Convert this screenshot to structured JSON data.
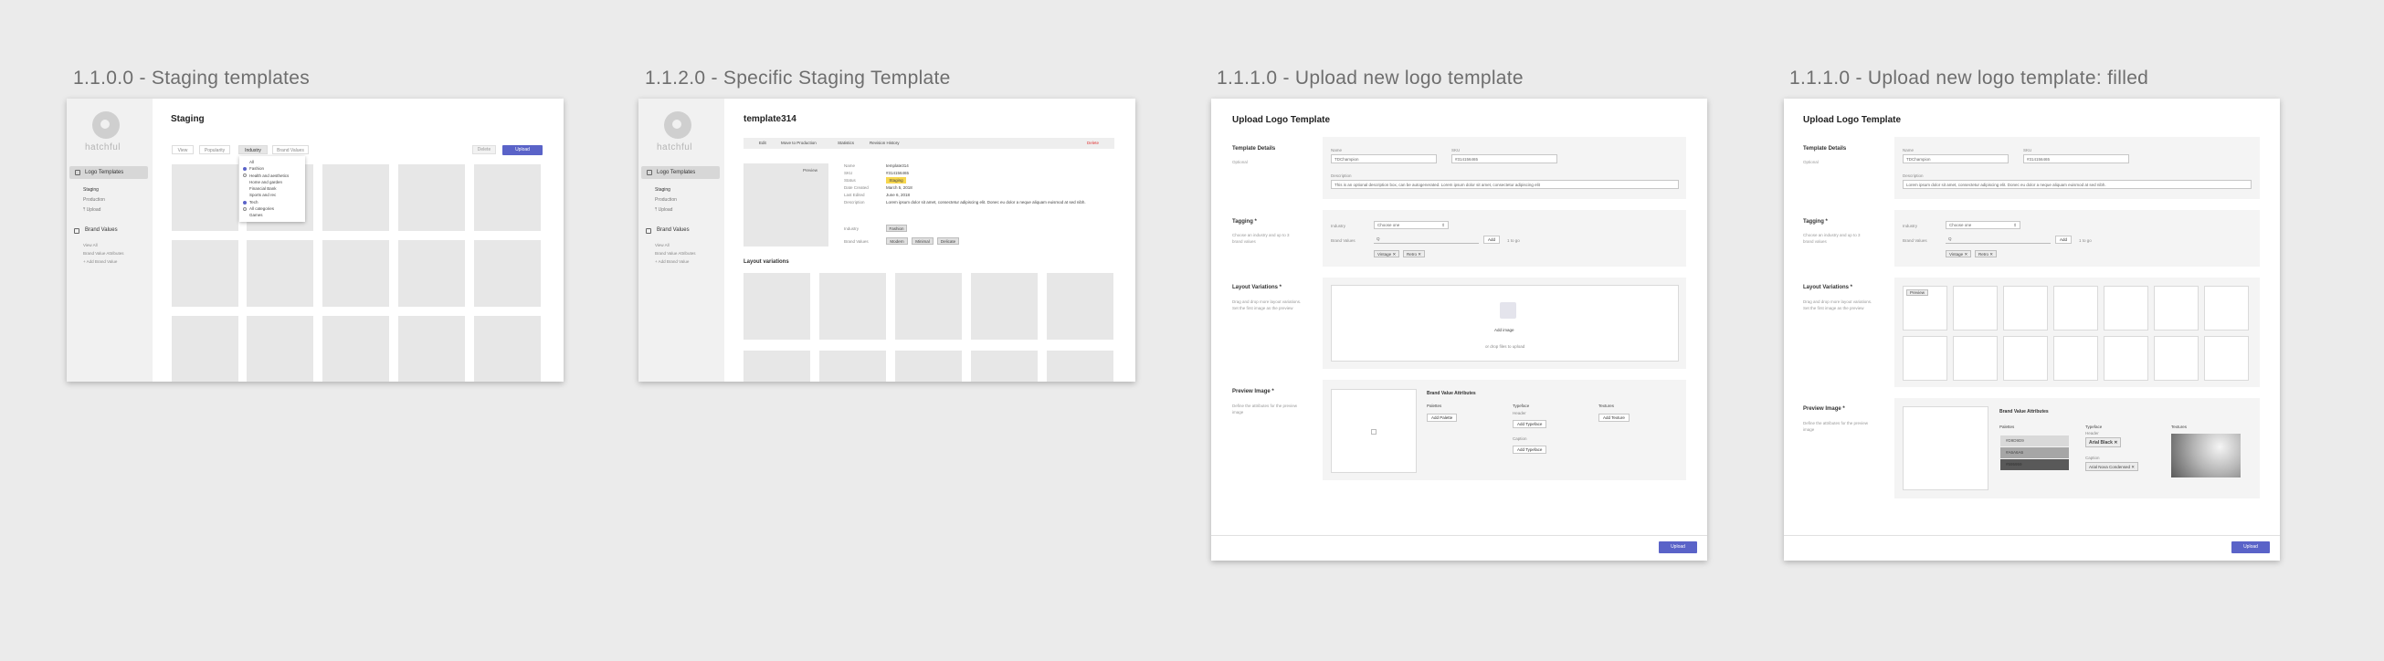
{
  "boards": [
    {
      "title": "1.1.0.0 - Staging templates"
    },
    {
      "title": "1.1.2.0 - Specific Staging Template"
    },
    {
      "title": "1.1.1.0 - Upload new logo template"
    },
    {
      "title": "1.1.1.0 - Upload new logo template: filled"
    }
  ],
  "sidebar": {
    "logo_text": "hatchful",
    "logo_templates": "Logo Templates",
    "staging": "Staging",
    "production": "Production",
    "upload": "Upload",
    "brand_values": "Brand Values",
    "view_all": "View All",
    "brand_value_attributes": "Brand Value Attributes",
    "add_brand_value": "Add Brand Value"
  },
  "staging": {
    "title": "Staging",
    "tabs": [
      "View",
      "Popularity",
      "Industry",
      "Brand Values"
    ],
    "active_tab": "Industry",
    "delete": "Delete",
    "upload": "Upload",
    "dropdown": [
      "All",
      "Fashion",
      "Health and aesthetics",
      "Home and garden",
      "Financial Bank",
      "Sports and rec",
      "Tech",
      "All categories",
      "Games"
    ],
    "dropdown_selected": [
      1,
      6
    ]
  },
  "specific": {
    "title": "template314",
    "tabs": [
      "Edit",
      "Move to Production",
      "Statistics",
      "Revision History"
    ],
    "delete": "Delete",
    "preview": "Preview",
    "fields": [
      {
        "label": "Name",
        "value": "template314"
      },
      {
        "label": "SKU",
        "value": "#314156465"
      },
      {
        "label": "Status",
        "value": "Staging"
      },
      {
        "label": "Date Created",
        "value": "March 5, 2018"
      },
      {
        "label": "Last Edited",
        "value": "June 6, 2018"
      },
      {
        "label": "Description",
        "value": "Lorem ipsum dolor sit amet, consectetur adipiscing elit. Donec eu dolor a neque aliquam euismod at sed nibh."
      }
    ],
    "industry_label": "Industry",
    "industry": "Fashion",
    "brand_values_label": "Brand Values",
    "brand_values": [
      "Modern",
      "Minimal",
      "Delicate"
    ],
    "layout_variations": "Layout variations"
  },
  "upload": {
    "title": "Upload Logo Template",
    "template_details": "Template Details",
    "optional": "Optional",
    "name_label": "Name",
    "name_value": "TDChampion",
    "sku_label": "SKU",
    "sku_value": "#314156465",
    "description_label": "Description",
    "description_placeholder": "This is an optional description box, can be autogenerated. Lorem ipsum dolor sit amet, consectetur adipiscing elit",
    "description_filled": "Lorem ipsum dolor sit amet, consectetur adipiscing elit. Donec eu dolor a neque aliquam euismod at sed nibh.",
    "tagging": "Tagging *",
    "tagging_desc": "Choose an industry and up to 3 brand values",
    "industry_label": "Industry",
    "industry_value": "Choose one",
    "brand_values_label": "Brand Values",
    "brand_input": "Q",
    "add": "Add",
    "to_go": "1 to go",
    "chips": [
      "Vintage",
      "Retro"
    ],
    "layout_variations": "Layout Variations *",
    "layout_desc": "Drag and drop more layout variations. Set the first image as the preview",
    "add_image": "Add image",
    "drop_files": "or drop files to upload",
    "preview_badge": "Preview",
    "preview_image": "Preview Image *",
    "preview_desc": "Define the attributes for the preview image",
    "bva_title": "Brand Value Attributes",
    "palettes": "Palettes",
    "typeface": "Typeface",
    "textures": "Textures",
    "add_palette": "Add Palette",
    "header": "Header",
    "caption": "Caption",
    "add_typeface": "Add Typeface",
    "add_texture": "Add Texture",
    "palette_colors": [
      "#D9D9D9",
      "#A6A6A6",
      "#595959"
    ],
    "header_font": "Arial Black",
    "caption_font": "Arial Nova Condensed",
    "upload_button": "Upload"
  }
}
